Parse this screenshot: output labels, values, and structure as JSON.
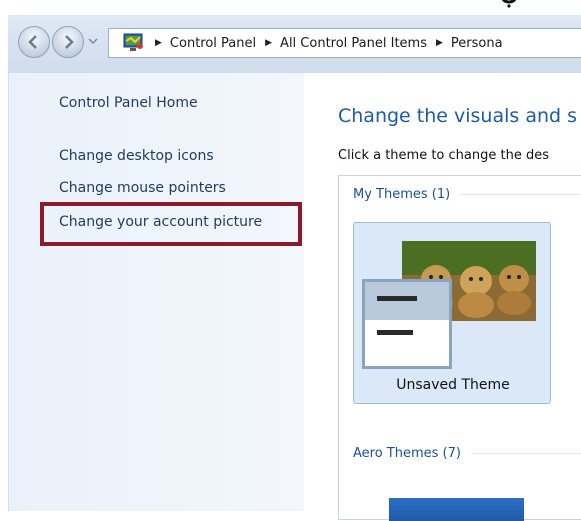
{
  "window": {
    "address_bar": {
      "icon": "control-panel-icon",
      "crumbs": [
        "Control Panel",
        "All Control Panel Items",
        "Persona"
      ]
    }
  },
  "sidebar": {
    "home_link": "Control Panel Home",
    "links": [
      "Change desktop icons",
      "Change mouse pointers",
      "Change your account picture"
    ],
    "highlight_color": "#8b1a2b"
  },
  "main": {
    "title": "Change the visuals and s",
    "subtitle": "Click a theme to change the des",
    "groups": [
      {
        "label": "My Themes (1)"
      },
      {
        "label": "Aero Themes (7)"
      }
    ],
    "selected_theme": {
      "label": "Unsaved Theme"
    }
  }
}
